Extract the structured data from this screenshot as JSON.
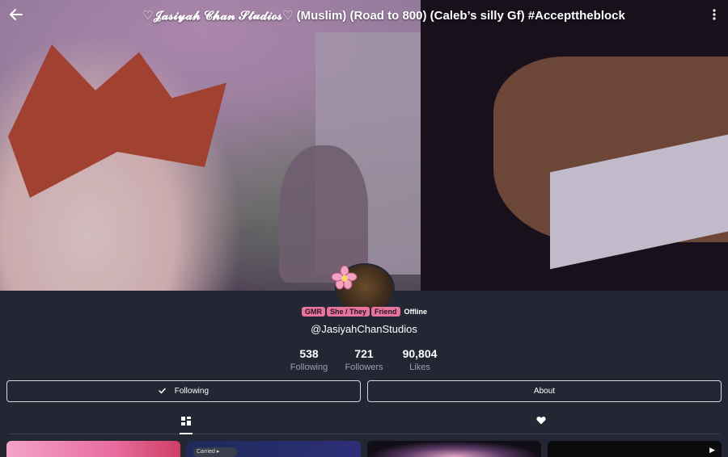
{
  "header": {
    "title": "♡𝓙𝓪𝓼𝓲𝔂𝓪𝓱 𝓒𝓱𝓪𝓷 𝓢𝓽𝓾𝓭𝓲𝓸𝓼♡ (Muslim) (Road to 800) (Caleb’s silly Gf) #Accepttheblock",
    "back_icon": "arrow-left-icon",
    "menu_icon": "more-vertical-icon"
  },
  "profile": {
    "tags": [
      "GMR",
      "She / They",
      "Friend"
    ],
    "status": "Offline",
    "handle": "@JasiyahChanStudios",
    "tag_color": "#e6749e"
  },
  "stats": [
    {
      "value": "538",
      "label": "Following"
    },
    {
      "value": "721",
      "label": "Followers"
    },
    {
      "value": "90,804",
      "label": "Likes"
    }
  ],
  "actions": {
    "following_label": "Following",
    "about_label": "About"
  },
  "tabs": {
    "grid_icon": "grid-icon",
    "likes_icon": "heart-icon"
  },
  "thumbnails": {
    "second_pill_text": "Carried ▸"
  },
  "colors": {
    "background": "#232733",
    "muted_text": "#9aa0ac"
  }
}
